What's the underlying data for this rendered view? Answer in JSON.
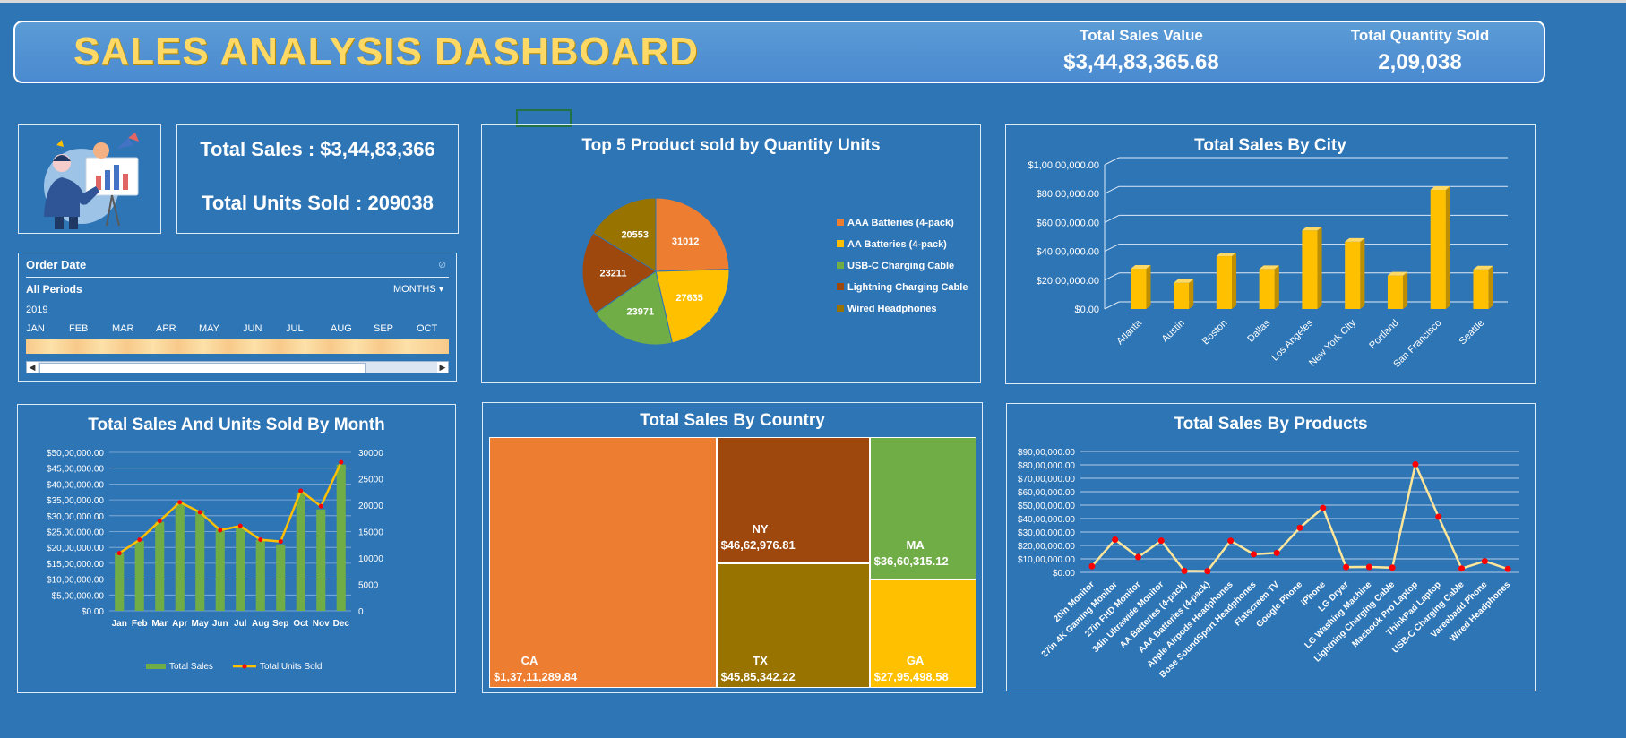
{
  "header": {
    "title": "SALES ANALYSIS DASHBOARD",
    "total_sales_label": "Total Sales Value",
    "total_sales_value": "$3,44,83,365.68",
    "total_qty_label": "Total Quantity Sold",
    "total_qty_value": "2,09,038"
  },
  "kpi": {
    "total_sales": "Total Sales : $3,44,83,366",
    "total_units": "Total Units Sold : 209038"
  },
  "slicer": {
    "title": "Order Date",
    "period": "All Periods",
    "level": "MONTHS",
    "year": "2019",
    "months": [
      "JAN",
      "FEB",
      "MAR",
      "APR",
      "MAY",
      "JUN",
      "JUL",
      "AUG",
      "SEP",
      "OCT"
    ]
  },
  "colors": {
    "background": "#2e75b6",
    "title": "#ffd966",
    "bar_gold": "#ffc000",
    "bar_green": "#70ad47",
    "line_yellow": "#ffc000",
    "marker_red": "#ff0000"
  },
  "chart_data": [
    {
      "id": "pie",
      "type": "pie",
      "title": "Top 5 Product sold by Quantity Units",
      "categories": [
        "AAA Batteries (4-pack)",
        "AA Batteries (4-pack)",
        "USB-C Charging Cable",
        "Lightning Charging Cable",
        "Wired Headphones"
      ],
      "values": [
        31012,
        27635,
        23971,
        23211,
        20553
      ],
      "colors": [
        "#ed7d31",
        "#ffc000",
        "#70ad47",
        "#9e480e",
        "#997300"
      ],
      "legend": "right"
    },
    {
      "id": "city",
      "type": "bar",
      "title": "Total Sales By City",
      "categories": [
        "Atlanta",
        "Austin",
        "Boston",
        "Dallas",
        "Los Angeles",
        "New York City",
        "Portland",
        "San Francisco",
        "Seattle"
      ],
      "values": [
        2795498.58,
        1819581.75,
        3661642.01,
        2767975.4,
        5452570.8,
        4664317.43,
        2320490.61,
        8262203.91,
        2747755.48
      ],
      "ylim": [
        0,
        10000000
      ],
      "yticks": [
        "$0.00",
        "$20,00,000.00",
        "$40,00,000.00",
        "$60,00,000.00",
        "$80,00,000.00",
        "$1,00,00,000.00"
      ],
      "grid": true
    },
    {
      "id": "month",
      "type": "bar",
      "title": "Total Sales And Units Sold By Month",
      "categories": [
        "Jan",
        "Feb",
        "Mar",
        "Apr",
        "May",
        "Jun",
        "Jul",
        "Aug",
        "Sep",
        "Oct",
        "Nov",
        "Dec"
      ],
      "series": [
        {
          "name": "Total Sales",
          "type": "bar",
          "axis": "left",
          "values": [
            1822257,
            2202022,
            2807100,
            3390670,
            3152607,
            2577802,
            2647776,
            2244468,
            2097560,
            3736727,
            3199603,
            4613443
          ]
        },
        {
          "name": "Total Units Sold",
          "type": "line",
          "axis": "right",
          "values": [
            10903,
            13449,
            17005,
            20558,
            18667,
            15253,
            16072,
            13448,
            13109,
            22703,
            19798,
            28114
          ]
        }
      ],
      "ylim_left": [
        0,
        5000000
      ],
      "ylim_right": [
        0,
        30000
      ],
      "yticks_left": [
        "$0.00",
        "$5,00,000.00",
        "$10,00,000.00",
        "$15,00,000.00",
        "$20,00,000.00",
        "$25,00,000.00",
        "$30,00,000.00",
        "$35,00,000.00",
        "$40,00,000.00",
        "$45,00,000.00",
        "$50,00,000.00"
      ],
      "yticks_right": [
        "0",
        "5000",
        "10000",
        "15000",
        "20000",
        "25000",
        "30000"
      ],
      "legend": "bottom"
    },
    {
      "id": "country",
      "type": "treemap",
      "title": "Total Sales By Country",
      "items": [
        {
          "name": "CA",
          "label": "$1,37,11,289.84",
          "value": 13711289.84,
          "color": "#ed7d31"
        },
        {
          "name": "NY",
          "label": "$46,62,976.81",
          "value": 4662976.81,
          "color": "#9e480e"
        },
        {
          "name": "TX",
          "label": "$45,85,342.22",
          "value": 4585342.22,
          "color": "#997300"
        },
        {
          "name": "MA",
          "label": "$36,60,315.12",
          "value": 3660315.12,
          "color": "#70ad47"
        },
        {
          "name": "GA",
          "label": "$27,95,498.58",
          "value": 2795498.58,
          "color": "#ffc000"
        }
      ]
    },
    {
      "id": "products",
      "type": "line",
      "title": "Total Sales By Products",
      "categories": [
        "20in Monitor",
        "27in 4K Gaming Monitor",
        "27in FHD Monitor",
        "34in Ultrawide Monitor",
        "AA Batteries (4-pack)",
        "AAA Batteries (4-pack)",
        "Apple Airpods Headphones",
        "Bose SoundSport Headphones",
        "Flatscreen TV",
        "Google Phone",
        "iPhone",
        "LG Dryer",
        "LG Washing Machine",
        "Lightning Charging Cable",
        "Macbook Pro Laptop",
        "ThinkPad Laptop",
        "USB-C Charging Cable",
        "Vareebadd Phone",
        "Wired Headphones"
      ],
      "values": [
        454148.71,
        2435097.56,
        1132424.5,
        2355558.01,
        106118.4,
        92740.83,
        2349150,
        1345565.43,
        1445700,
        3319200,
        4794300,
        387600,
        399600,
        347094.15,
        8037600,
        4129958.7,
        286501.25,
        827200,
        246478.43
      ],
      "ylim": [
        0,
        9000000
      ],
      "yticks": [
        "$0.00",
        "$10,00,000.00",
        "$20,00,000.00",
        "$30,00,000.00",
        "$40,00,000.00",
        "$50,00,000.00",
        "$60,00,000.00",
        "$70,00,000.00",
        "$80,00,000.00",
        "$90,00,000.00"
      ],
      "grid": true
    }
  ]
}
